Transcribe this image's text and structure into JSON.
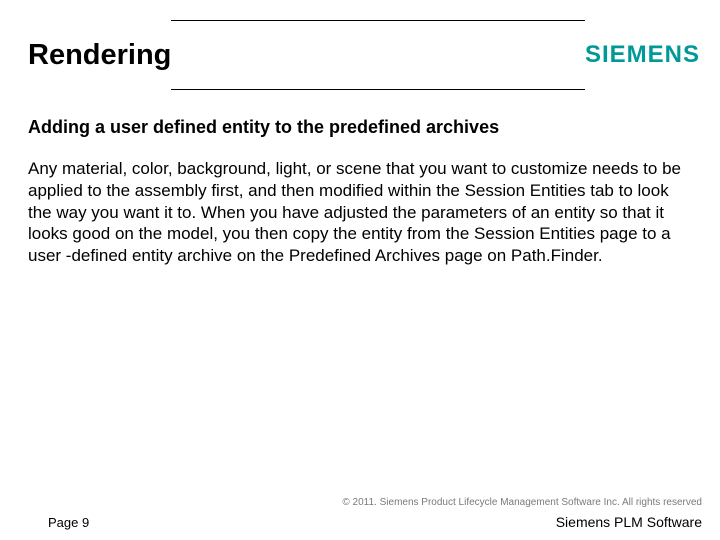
{
  "header": {
    "title": "Rendering",
    "brand": "SIEMENS"
  },
  "content": {
    "subheading": "Adding a user defined entity to the predefined archives",
    "body": "Any material, color, background, light, or scene that you want to customize needs to be applied to the assembly first, and then modified within the Session Entities tab to look the way you want it to. When you have adjusted the parameters of an entity so that it looks good on the model, you then copy the entity from the Session Entities page to a user -defined entity archive on the Predefined Archives page on Path.Finder."
  },
  "footer": {
    "copyright": "© 2011. Siemens Product Lifecycle Management Software Inc. All rights reserved",
    "page": "Page 9",
    "brand": "Siemens PLM Software"
  }
}
